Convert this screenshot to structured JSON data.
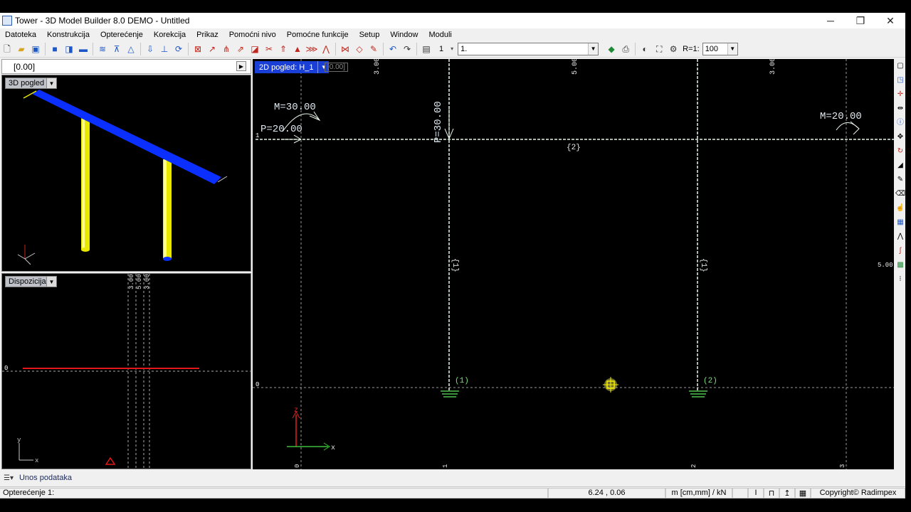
{
  "window": {
    "title": "Tower - 3D Model Builder 8.0 DEMO - Untitled",
    "minimize": "─",
    "maximize": "❐",
    "close": "✕"
  },
  "menu": [
    "Datoteka",
    "Konstrukcija",
    "Opterećenje",
    "Korekcija",
    "Prikaz",
    "Pomoćni nivo",
    "Pomoćne funkcije",
    "Setup",
    "Window",
    "Moduli"
  ],
  "toolbar": {
    "load_case_index": "1",
    "load_case_select": "1.",
    "ratio_label": "R=1:",
    "ratio_value": "100"
  },
  "left_header": {
    "level": "[0.00]"
  },
  "panels": {
    "view3d_label": "3D pogled",
    "layout_label": "Dispozicija",
    "layout_dims": [
      "3.00",
      "5.00",
      "3.00"
    ],
    "layout_level": "0",
    "axis_x": "x",
    "axis_y": "y",
    "axis_z": "z"
  },
  "main_view": {
    "tab_label": "2D pogled: H_1",
    "level_box": "[0.00]",
    "top_dims": [
      "3.00",
      "5.00",
      "3.00"
    ],
    "right_dim": "5.00",
    "level_top": "1",
    "level_bottom": "0",
    "loads": {
      "left_moment": "M=30.00",
      "left_force": "P=20.00",
      "vertical_force": "P=30.00",
      "right_moment": "M=20.00"
    },
    "element_labels": {
      "beam": "{2}",
      "col_left": "{1}",
      "col_right": "{1}"
    },
    "support_labels": [
      "(1)",
      "(2)"
    ],
    "axis_labels_bottom": [
      "0",
      "1",
      "2",
      "3"
    ],
    "axis_x": "x",
    "axis_z": "z"
  },
  "bottom_tab": {
    "label": "Unos podataka"
  },
  "status": {
    "load": "Opterećenje 1:",
    "coords": "6.24 , 0.06",
    "units": "m [cm,mm] / kN",
    "copyright": "Copyright© Radimpex"
  },
  "colors": {
    "beam_3d": "#0a2fff",
    "column_3d": "#e8e800",
    "red_line": "#e01818",
    "frame": "#e8f4e8",
    "label_green": "#7fdc7f"
  }
}
